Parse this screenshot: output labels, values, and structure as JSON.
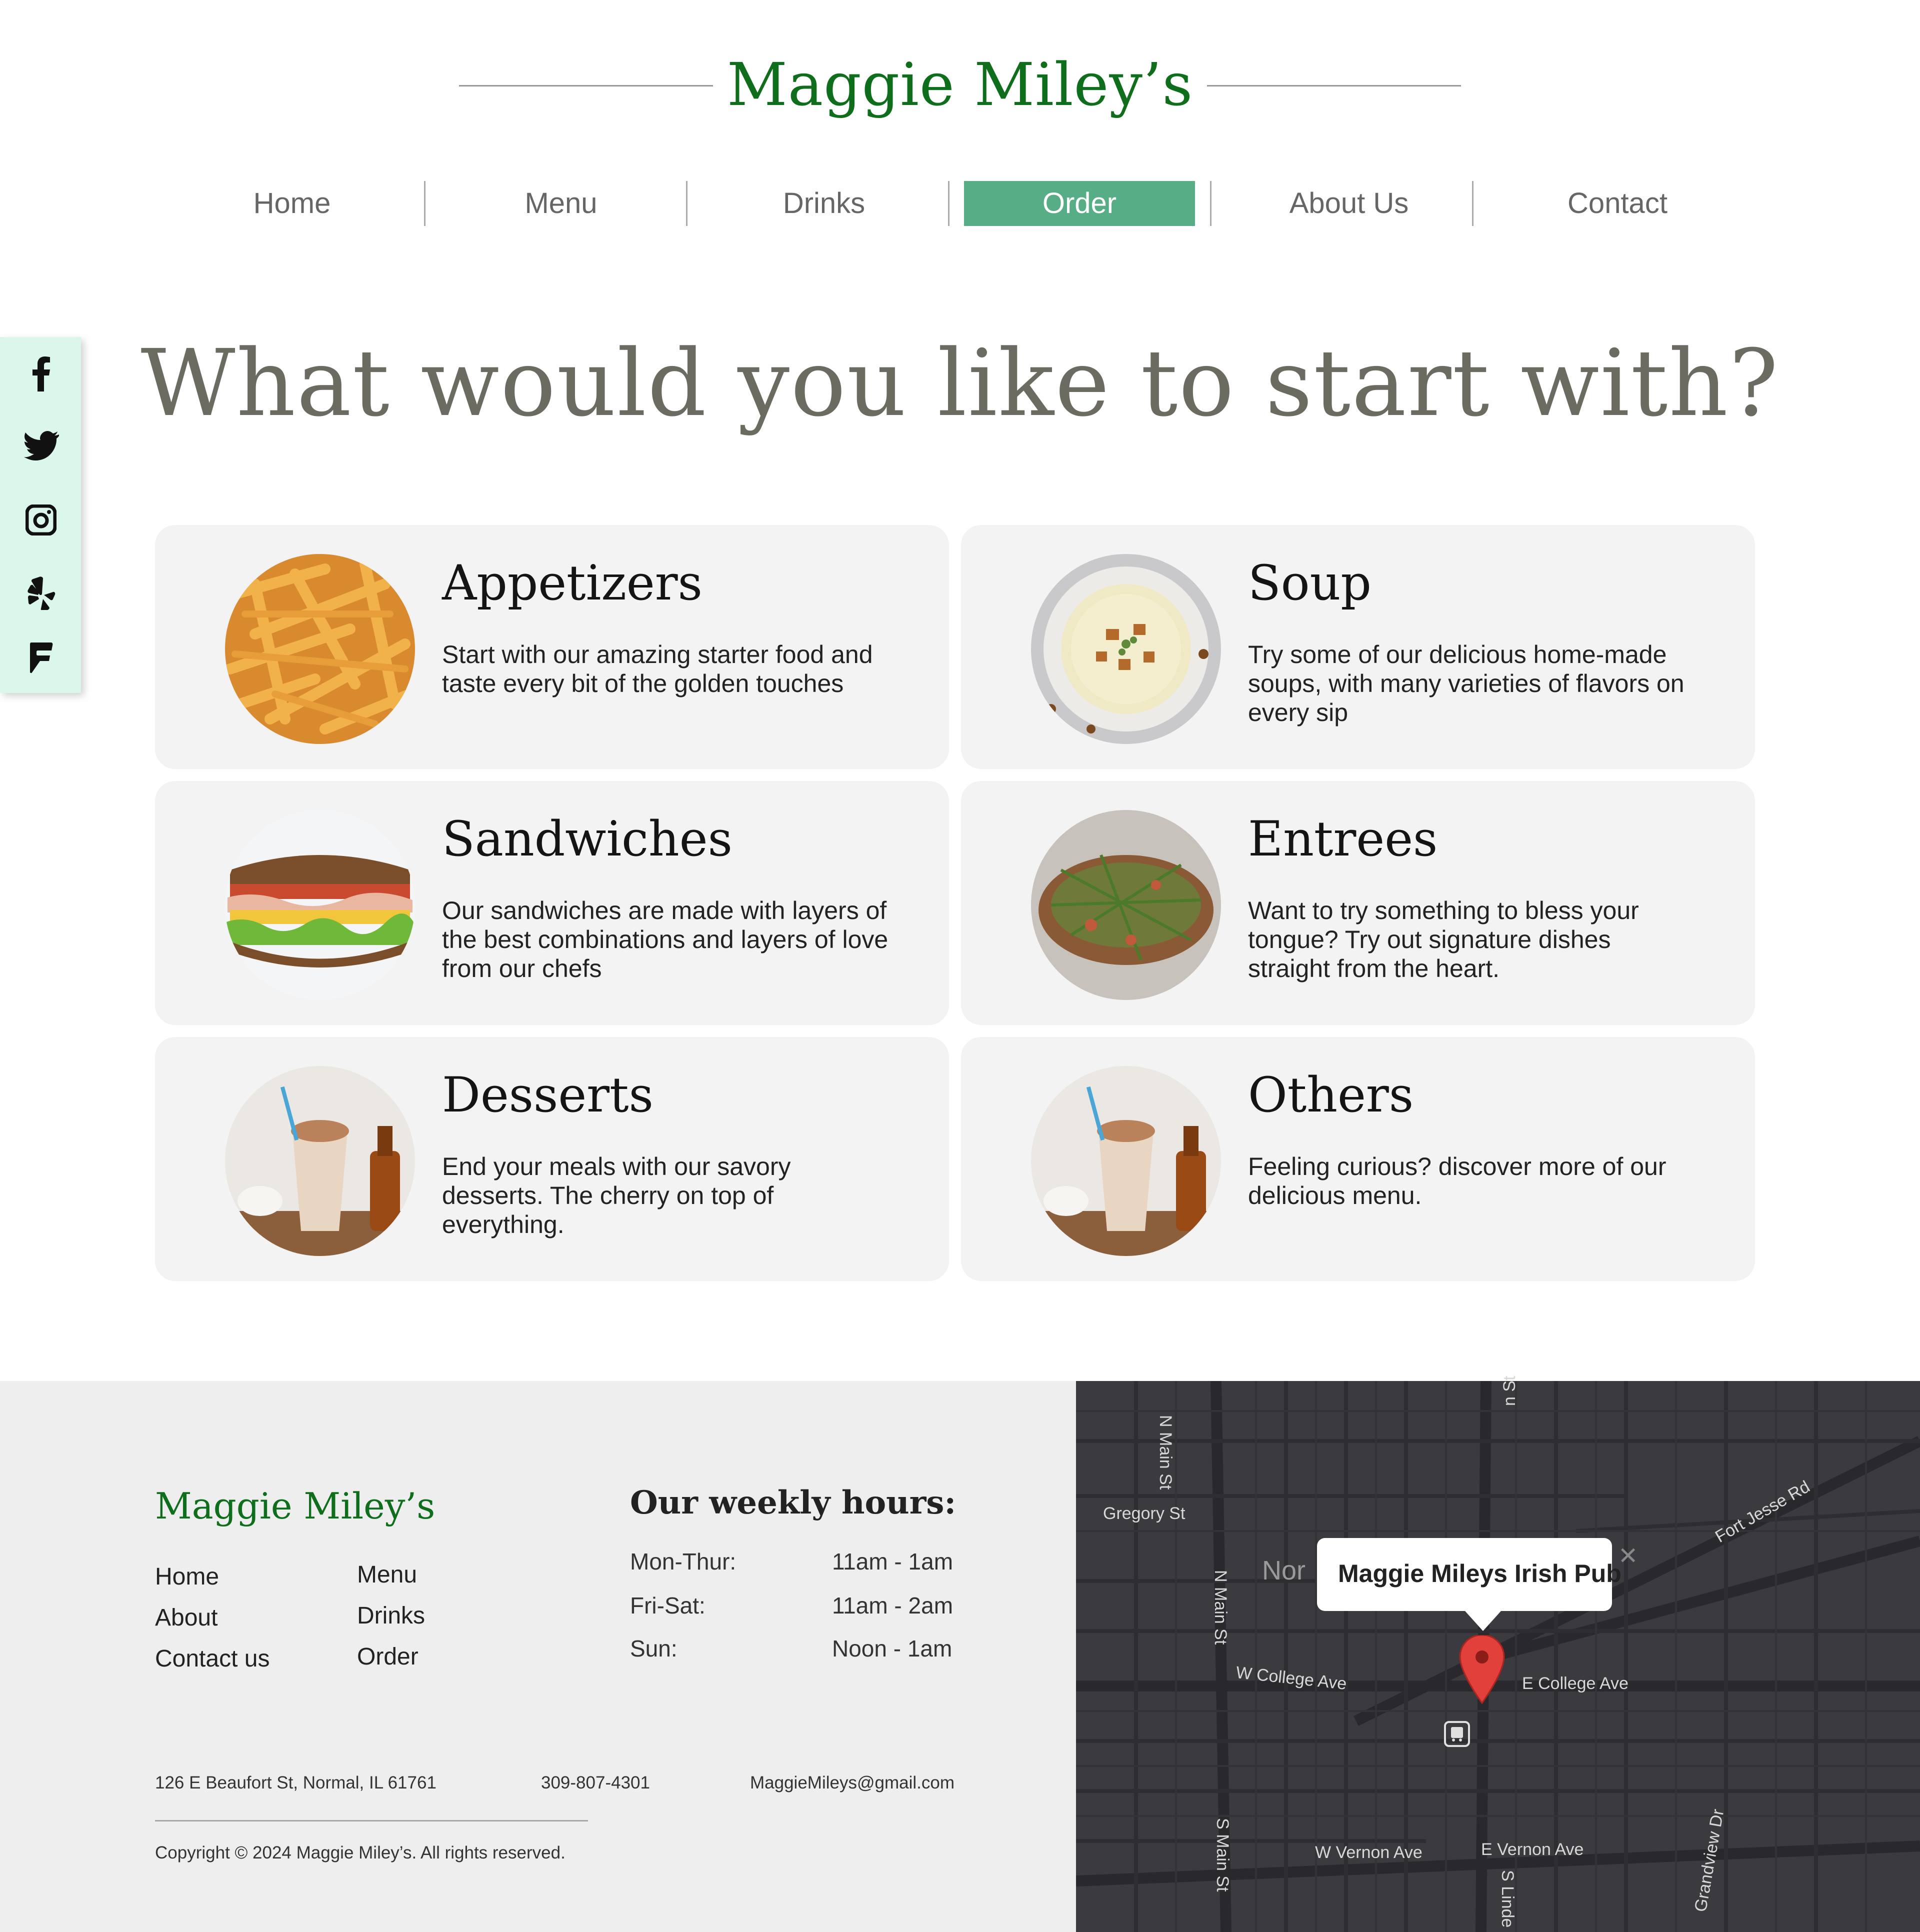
{
  "header": {
    "logo": "Maggie Miley’s"
  },
  "nav": {
    "items": [
      {
        "label": "Home"
      },
      {
        "label": "Menu"
      },
      {
        "label": "Drinks"
      },
      {
        "label": "Order"
      },
      {
        "label": "About Us"
      },
      {
        "label": "Contact"
      }
    ],
    "active": "Order",
    "active_color": "#57ad85"
  },
  "social": {
    "background": "#dbf7ec",
    "icons": [
      "facebook-icon",
      "twitter-icon",
      "instagram-icon",
      "yelp-icon",
      "foursquare-icon"
    ]
  },
  "main": {
    "heading": "What would you like to start with?",
    "categories": [
      {
        "title": "Appetizers",
        "description": "Start with our amazing starter food and taste every bit of the golden touches",
        "image": "fries"
      },
      {
        "title": "Soup",
        "description": "Try some of our delicious home-made soups, with many varieties of flavors on every sip",
        "image": "soup"
      },
      {
        "title": "Sandwiches",
        "description": "Our sandwiches are made with layers of the best combinations and layers of love from our chefs",
        "image": "sandwich"
      },
      {
        "title": "Entrees",
        "description": "Want to try something to bless your tongue? Try out signature dishes straight from the heart.",
        "image": "roast"
      },
      {
        "title": "Desserts",
        "description": "End your meals with our savory desserts. The cherry on top of everything.",
        "image": "milkshake"
      },
      {
        "title": "Others",
        "description": "Feeling curious? discover more of our delicious menu.",
        "image": "milkshake"
      }
    ]
  },
  "footer": {
    "logo": "Maggie Miley’s",
    "links_col1": [
      "Home",
      "About",
      "Contact us"
    ],
    "links_col2": [
      "Menu",
      "Drinks",
      "Order"
    ],
    "hours_title": "Our weekly hours:",
    "hours": [
      {
        "day": "Mon-Thur:",
        "time": "11am - 1am"
      },
      {
        "day": "Fri-Sat:",
        "time": "11am - 2am"
      },
      {
        "day": "Sun:",
        "time": "Noon - 1am"
      }
    ],
    "address": "126 E Beaufort St, Normal, IL 61761",
    "phone": "309-807-4301",
    "email": "MaggieMileys@gmail.com",
    "copyright": "Copyright © 2024 Maggie Miley’s. All rights reserved."
  },
  "map": {
    "popup_title": "Maggie Mileys Irish Pub",
    "labels": {
      "gregory": "Gregory St",
      "n_main_top": "N Main St",
      "n_main_mid": "N Main St",
      "top_st": "n St",
      "fort_jesse": "Fort Jesse Rd",
      "normal": "Nor",
      "w_college": "W College Ave",
      "e_college": "E College Ave",
      "w_vernon": "W Vernon Ave",
      "e_vernon": "E Vernon Ave",
      "s_main": "S Main St",
      "s_linden": "S Linde",
      "grandview": "Grandview Dr"
    }
  }
}
